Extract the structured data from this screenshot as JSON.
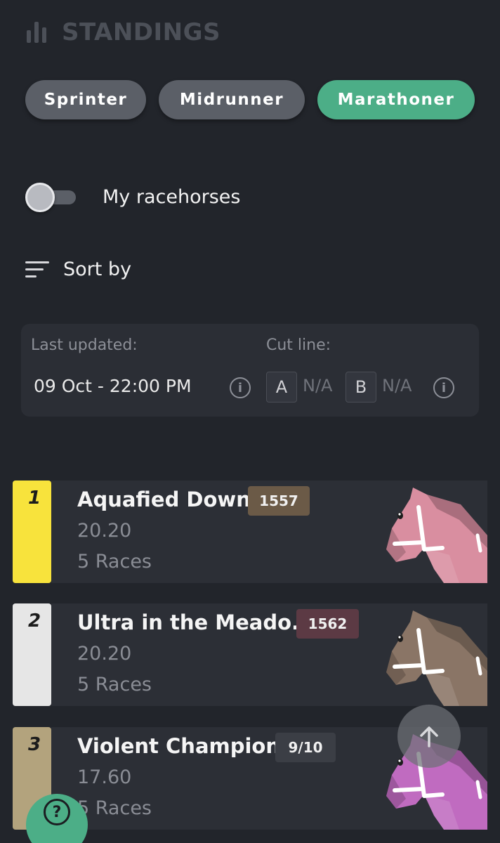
{
  "header": {
    "title": "STANDINGS",
    "icon": "bar-chart-icon"
  },
  "categories": [
    {
      "label": "Sprinter",
      "active": false
    },
    {
      "label": "Midrunner",
      "active": false
    },
    {
      "label": "Marathoner",
      "active": true
    }
  ],
  "filter": {
    "label": "My racehorses",
    "enabled": false
  },
  "sort": {
    "label": "Sort by"
  },
  "info": {
    "last_updated_label": "Last updated:",
    "last_updated_value": "09 Oct - 22:00 PM",
    "cut_line_label": "Cut line:",
    "tier_a": "A",
    "tier_a_value": "N/A",
    "tier_b": "B",
    "tier_b_value": "N/A"
  },
  "standings": [
    {
      "rank": "1",
      "name": "Aquafied Down",
      "badge": "1557",
      "score": "20.20",
      "races": "5 Races",
      "rank_color": "#f8e33c",
      "badge_color": "#6b5a47",
      "horse_color": "#d98ea0"
    },
    {
      "rank": "2",
      "name": "Ultra in the Meado...",
      "badge": "1562",
      "score": "20.20",
      "races": "5 Races",
      "rank_color": "#e6e6e6",
      "badge_color": "#5c3a44",
      "horse_color": "#8a7566"
    },
    {
      "rank": "3",
      "name": "Violent Champion",
      "badge": "9/10",
      "score": "17.60",
      "races": "5 Races",
      "rank_color": "#b3a37d",
      "badge_color": "#3b3e45",
      "horse_color": "#c06bc0"
    }
  ],
  "colors": {
    "accent": "#4cae87",
    "background": "#22252b",
    "card": "#2c2f36"
  }
}
